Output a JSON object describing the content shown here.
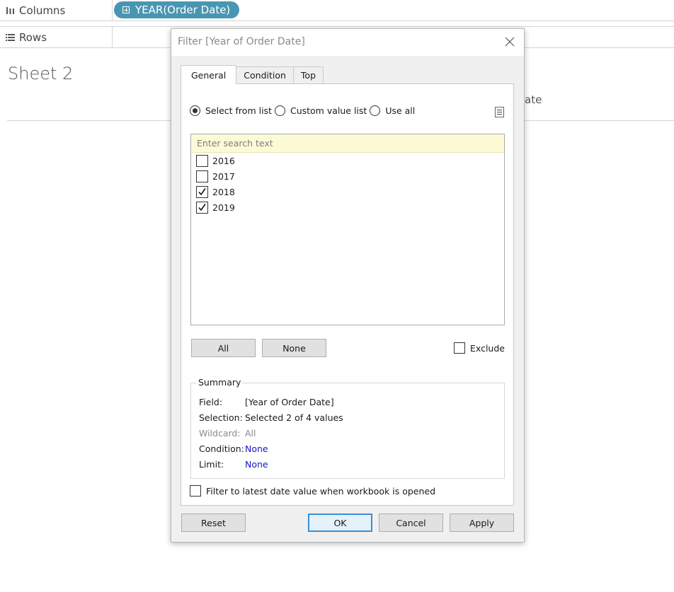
{
  "workbook": {
    "columns_label": "Columns",
    "rows_label": "Rows",
    "columns_pill": "YEAR(Order Date)",
    "sheet_title": "Sheet 2",
    "peek_text": "ate"
  },
  "dialog": {
    "title": "Filter [Year of Order Date]",
    "tabs": [
      "General",
      "Condition",
      "Top"
    ],
    "active_tab": "General",
    "radios": [
      {
        "label": "Select from list",
        "selected": true
      },
      {
        "label": "Custom value list",
        "selected": false
      },
      {
        "label": "Use all",
        "selected": false
      }
    ],
    "search_placeholder": "Enter search text",
    "list_items": [
      {
        "label": "2016",
        "checked": false
      },
      {
        "label": "2017",
        "checked": false
      },
      {
        "label": "2018",
        "checked": true
      },
      {
        "label": "2019",
        "checked": true
      }
    ],
    "all_button": "All",
    "none_button": "None",
    "exclude_label": "Exclude",
    "exclude_checked": false,
    "summary": {
      "legend": "Summary",
      "field_label": "Field:",
      "field_value": "[Year of Order Date]",
      "selection_label": "Selection:",
      "selection_value": "Selected 2 of 4 values",
      "wildcard_label": "Wildcard:",
      "wildcard_value": "All",
      "condition_label": "Condition:",
      "condition_value": "None",
      "limit_label": "Limit:",
      "limit_value": "None"
    },
    "latest_label": "Filter to latest date value when workbook is opened",
    "latest_checked": false,
    "reset_button": "Reset",
    "ok_button": "OK",
    "cancel_button": "Cancel",
    "apply_button": "Apply"
  },
  "colors": {
    "pill": "#4996b2",
    "search_bg": "#fdfbd6",
    "link": "#1515c8",
    "primary_border": "#3a8fd6"
  },
  "icons": {
    "columns": "columns-icon",
    "rows": "rows-icon",
    "close": "close-icon",
    "menu": "list-menu-icon",
    "checkbox": "checkbox-icon"
  }
}
